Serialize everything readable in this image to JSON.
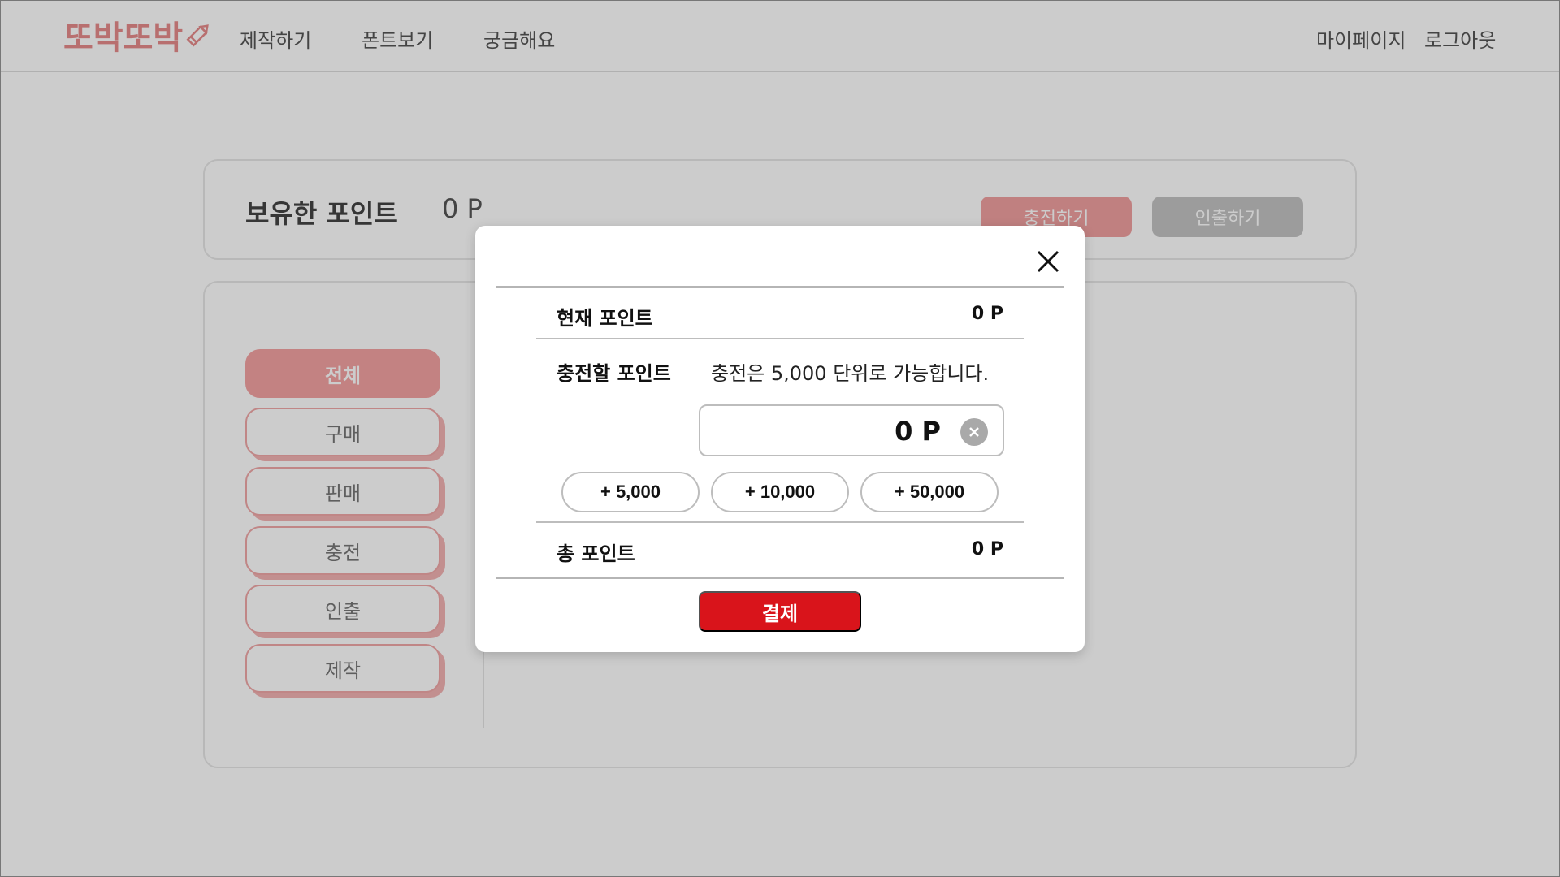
{
  "header": {
    "logo": "또박또박",
    "nav": [
      "제작하기",
      "폰트보기",
      "궁금해요"
    ],
    "my_page": "마이페이지",
    "logout": "로그아웃"
  },
  "points_panel": {
    "label": "보유한 포인트",
    "value": "0 P",
    "charge_button": "충전하기",
    "withdraw_button": "인출하기"
  },
  "history": {
    "filters": [
      "전체",
      "구매",
      "판매",
      "충전",
      "인출",
      "제작"
    ],
    "active_filter": "전체"
  },
  "modal": {
    "current_points_label": "현재 포인트",
    "current_points_value": "0 P",
    "charge_points_label": "충전할 포인트",
    "charge_hint": "충전은 5,000 단위로 가능합니다.",
    "amount_value": "0 P",
    "add_buttons": [
      "+ 5,000",
      "+ 10,000",
      "+ 50,000"
    ],
    "total_points_label": "총 포인트",
    "total_points_value": "0 P",
    "pay_button": "결제"
  },
  "colors": {
    "brand_pink": "#e78b8b",
    "charge_pink": "#f0a0a0",
    "pay_red": "#d9141b"
  }
}
